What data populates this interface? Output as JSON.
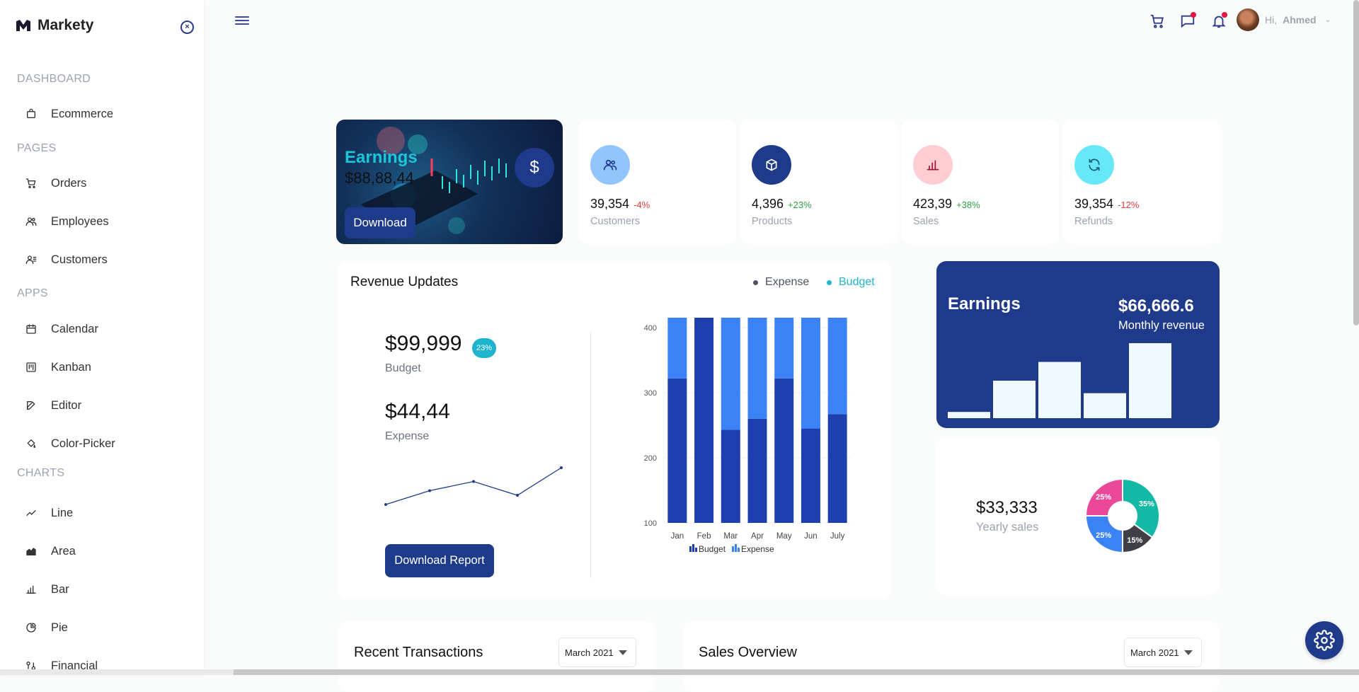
{
  "brand": {
    "name": "Markety"
  },
  "sidebar": {
    "sections": [
      {
        "title": "DASHBOARD",
        "items": [
          {
            "label": "Ecommerce",
            "icon": "shopping-bag-icon"
          }
        ]
      },
      {
        "title": "PAGES",
        "items": [
          {
            "label": "Orders",
            "icon": "cart-icon"
          },
          {
            "label": "Employees",
            "icon": "users-icon"
          },
          {
            "label": "Customers",
            "icon": "user-list-icon"
          }
        ]
      },
      {
        "title": "APPS",
        "items": [
          {
            "label": "Calendar",
            "icon": "calendar-icon"
          },
          {
            "label": "Kanban",
            "icon": "kanban-icon"
          },
          {
            "label": "Editor",
            "icon": "edit-icon"
          },
          {
            "label": "Color-Picker",
            "icon": "paint-bucket-icon"
          }
        ]
      },
      {
        "title": "CHARTS",
        "items": [
          {
            "label": "Line",
            "icon": "line-chart-icon"
          },
          {
            "label": "Area",
            "icon": "area-chart-icon"
          },
          {
            "label": "Bar",
            "icon": "bar-chart-icon"
          },
          {
            "label": "Pie",
            "icon": "pie-chart-icon"
          },
          {
            "label": "Financial",
            "icon": "financial-chart-icon"
          }
        ]
      }
    ]
  },
  "topbar": {
    "greeting": "Hi,",
    "username": "Ahmed"
  },
  "earnings_banner": {
    "title": "Earnings",
    "amount": "$88,88,44",
    "button": "Download",
    "icon": "dollar-icon"
  },
  "stats": [
    {
      "value": "39,354",
      "change": "-4%",
      "label": "Customers",
      "icon": "users-icon",
      "bg": "#93c5fd",
      "fg": "#1e3a8a",
      "trend": "neg"
    },
    {
      "value": "4,396",
      "change": "+23%",
      "label": "Products",
      "icon": "box-icon",
      "bg": "#1e3a8a",
      "fg": "#ffffff",
      "trend": "pos"
    },
    {
      "value": "423,39",
      "change": "+38%",
      "label": "Sales",
      "icon": "bar-chart-icon",
      "bg": "#fecdd3",
      "fg": "#9f1239",
      "trend": "pos"
    },
    {
      "value": "39,354",
      "change": "-12%",
      "label": "Refunds",
      "icon": "refresh-icon",
      "bg": "#67e8f9",
      "fg": "#155e75",
      "trend": "neg"
    }
  ],
  "revenue": {
    "title": "Revenue Updates",
    "legend_expense": "Expense",
    "legend_budget": "Budget",
    "budget_value": "$99,999",
    "budget_badge": "23%",
    "budget_label": "Budget",
    "expense_value": "$44,44",
    "expense_label": "Expense",
    "button": "Download Report"
  },
  "earnings_card": {
    "title": "Earnings",
    "value": "$66,666.6",
    "subtitle": "Monthly revenue"
  },
  "yearly": {
    "value": "$33,333",
    "label": "Yearly sales"
  },
  "recent": {
    "title": "Recent Transactions",
    "month": "March 2021"
  },
  "sales_overview": {
    "title": "Sales Overview",
    "month": "March 2021"
  },
  "colors": {
    "primary": "#1e3a8a",
    "accent": "#1fb5ce",
    "expense_bar": "#3b82f6",
    "budget_bar": "#1e40af"
  },
  "chart_data": [
    {
      "type": "bar",
      "stacked": true,
      "categories": [
        "Jan",
        "Feb",
        "Mar",
        "Apr",
        "May",
        "Jun",
        "July"
      ],
      "series": [
        {
          "name": "Budget",
          "values": [
            222,
            337,
            143,
            160,
            222,
            145,
            167
          ]
        },
        {
          "name": "Expense",
          "values": [
            178,
            63,
            257,
            240,
            178,
            255,
            233
          ]
        }
      ],
      "yticks": [
        100,
        200,
        300,
        400
      ],
      "ylim": [
        100,
        400
      ],
      "legend": "bottom"
    },
    {
      "type": "line",
      "x": [
        1,
        2,
        3,
        4,
        5
      ],
      "values": [
        2,
        5,
        7,
        4,
        10
      ],
      "ylim": [
        0,
        12
      ]
    },
    {
      "type": "bar",
      "values": [
        1,
        6,
        9,
        4,
        12
      ],
      "ylim": [
        0,
        12
      ]
    },
    {
      "type": "pie",
      "donut": true,
      "slices": [
        {
          "label": "35%",
          "value": 35,
          "color": "#14b8a6"
        },
        {
          "label": "15%",
          "value": 15,
          "color": "#3f3f46"
        },
        {
          "label": "25%",
          "value": 25,
          "color": "#3b82f6"
        },
        {
          "label": "25%",
          "value": 25,
          "color": "#ec4899"
        }
      ]
    }
  ]
}
